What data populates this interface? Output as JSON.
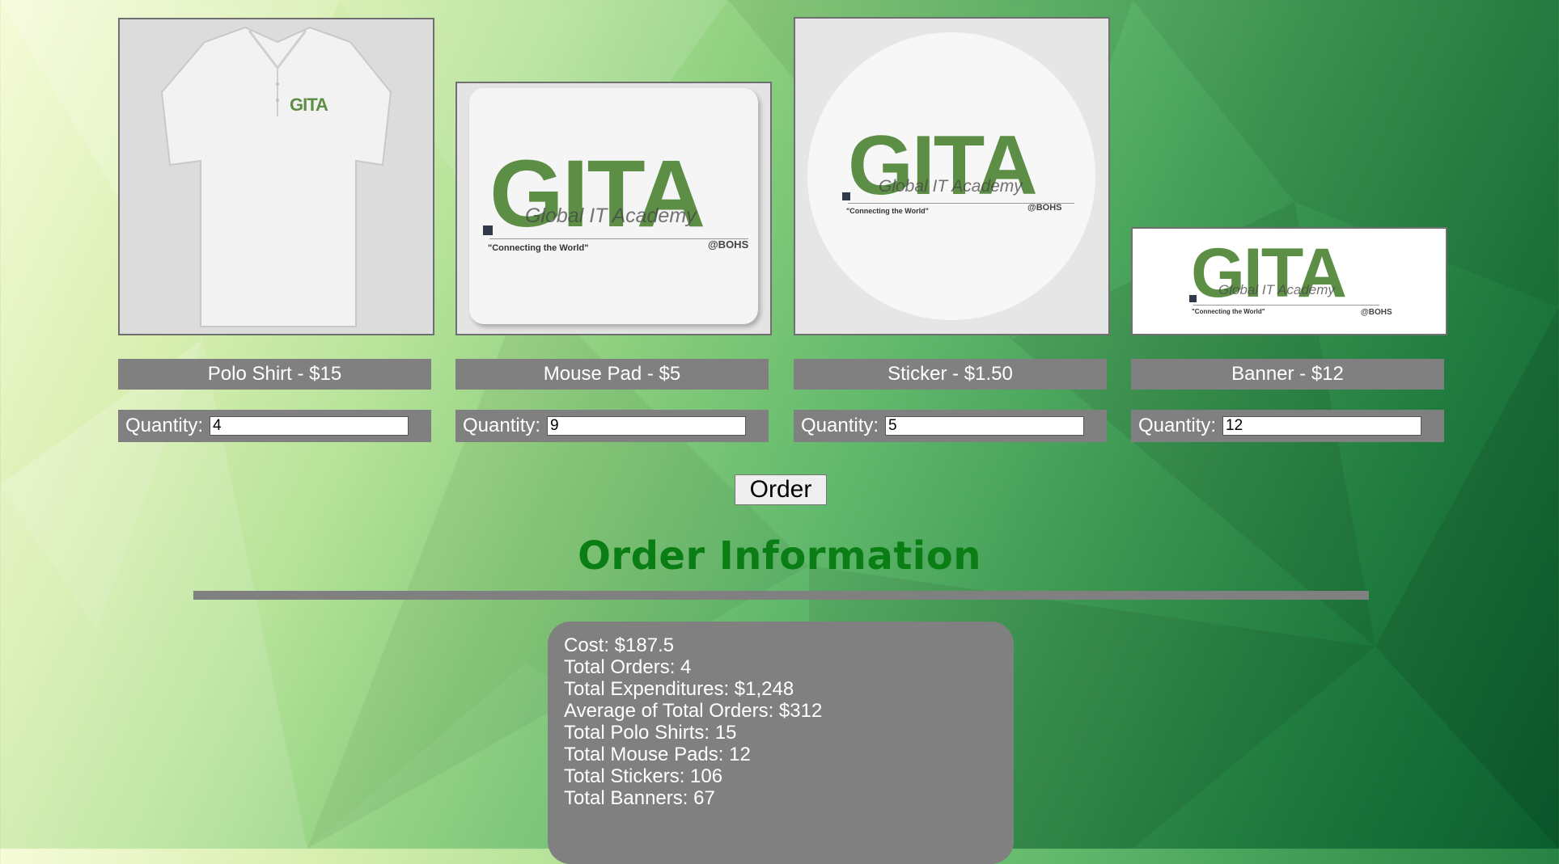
{
  "logo": {
    "main": "GITA",
    "academy": "Global IT Academy",
    "tagline": "\"Connecting the World\"",
    "suffix": "@BOHS"
  },
  "products": [
    {
      "label": "Polo Shirt - $15",
      "quantity_label": "Quantity:",
      "quantity": "4"
    },
    {
      "label": "Mouse Pad - $5",
      "quantity_label": "Quantity:",
      "quantity": "9"
    },
    {
      "label": "Sticker - $1.50",
      "quantity_label": "Quantity:",
      "quantity": "5"
    },
    {
      "label": "Banner - $12",
      "quantity_label": "Quantity:",
      "quantity": "12"
    }
  ],
  "order_button": "Order",
  "order_info": {
    "title": "Order Information",
    "lines": [
      "Cost: $187.5",
      "Total Orders: 4",
      "Total Expenditures: $1,248",
      "Average of Total Orders: $312",
      "Total Polo Shirts: 15",
      "Total Mouse Pads: 12",
      "Total Stickers: 106",
      "Total Banners: 67"
    ]
  },
  "colors": {
    "title_green": "#0a7d14",
    "panel_gray": "#808080",
    "logo_green": "#5c8f45"
  }
}
